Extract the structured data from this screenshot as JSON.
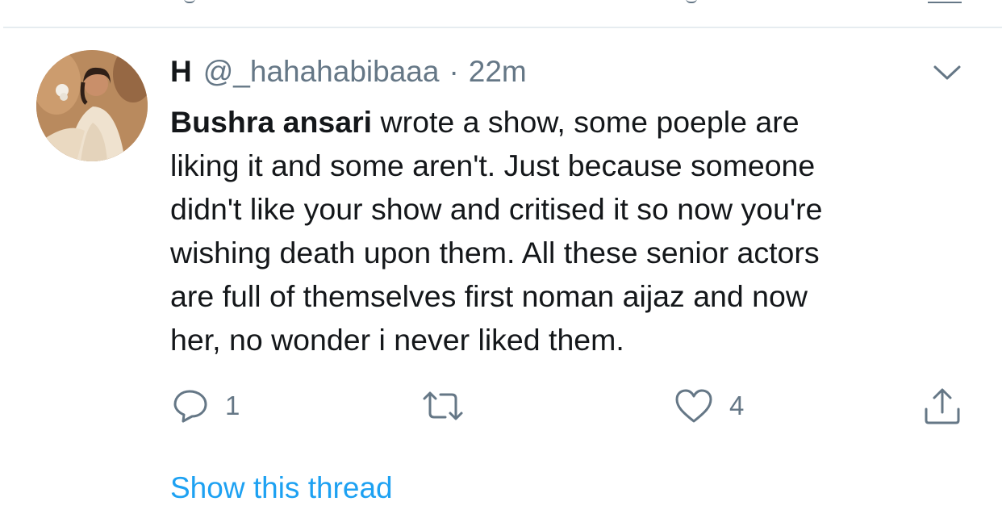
{
  "tweet": {
    "display_name": "H",
    "handle": "@_hahahabibaaa",
    "separator": "·",
    "time": "22m",
    "mention": "Bushra ansari",
    "text_lines": [
      " wrote a show, some poeple are",
      "liking it and some aren't. Just because someone",
      "didn't like your show and critised it so now you're",
      "wishing death upon them. All these senior actors",
      "are full of themselves first noman aijaz and now",
      "her, no wonder i never liked them."
    ],
    "avatar_icon": "profile-photo",
    "menu_icon": "chevron-down-icon"
  },
  "actions": {
    "reply": {
      "icon": "reply-icon",
      "count": "1"
    },
    "retweet": {
      "icon": "retweet-icon",
      "count": ""
    },
    "like": {
      "icon": "heart-icon",
      "count": "4"
    },
    "share": {
      "icon": "share-icon"
    }
  },
  "show_thread_label": "Show this thread",
  "colors": {
    "text": "#14171a",
    "secondary": "#657786",
    "link": "#1da1f2",
    "divider": "#e6ecf0"
  }
}
